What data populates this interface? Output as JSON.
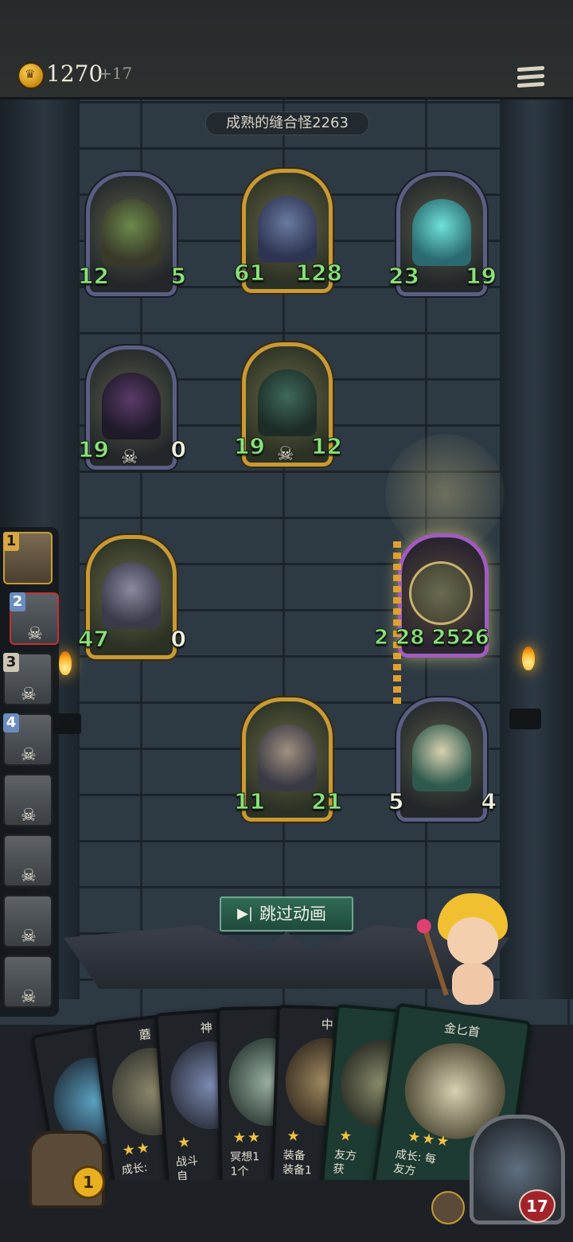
{
  "header": {
    "coins": "1270",
    "coins_gain": "+17"
  },
  "battle": {
    "enemy_title": "成熟的缝合怪2263",
    "skip_label": "跳过动画",
    "attack_damage": "2 28 2526",
    "units": [
      {
        "atk": "12",
        "hp": "5",
        "dead": false
      },
      {
        "atk": "61",
        "hp": "128",
        "dead": false
      },
      {
        "atk": "23",
        "hp": "19",
        "dead": false
      },
      {
        "atk": "19",
        "hp": "0",
        "dead": true
      },
      {
        "atk": "19",
        "hp": "12",
        "dead": true
      },
      {
        "atk": "47",
        "hp": "0",
        "dead": false
      },
      {
        "atk": "11",
        "hp": "21",
        "dead": false
      },
      {
        "atk": "5",
        "hp": "4",
        "dead": false
      }
    ]
  },
  "roster": {
    "slots": [
      {
        "number": "1"
      },
      {
        "number": "2"
      },
      {
        "number": "3"
      },
      {
        "number": "4"
      },
      {
        "number": ""
      },
      {
        "number": ""
      },
      {
        "number": ""
      },
      {
        "number": ""
      }
    ]
  },
  "hand": {
    "cards": [
      {
        "name": "",
        "text": ""
      },
      {
        "name": "蘑",
        "text": "成长:"
      },
      {
        "name": "神",
        "text": "战斗\n自"
      },
      {
        "name": "",
        "text": "冥想1\n1个"
      },
      {
        "name": "中",
        "text": "装备\n装备1"
      },
      {
        "name": "",
        "text": "友方\n获"
      },
      {
        "name": "金匕首",
        "text": "成长: 每\n友方"
      }
    ]
  },
  "bottom": {
    "chest_count": "1",
    "hero_life": "17"
  },
  "colors": {
    "gold": "#c89a36",
    "attack_blue": "#2b6d9a",
    "health_red": "#a9262c",
    "stat_green": "#8be07b",
    "skip_green": "#2f6b56"
  }
}
